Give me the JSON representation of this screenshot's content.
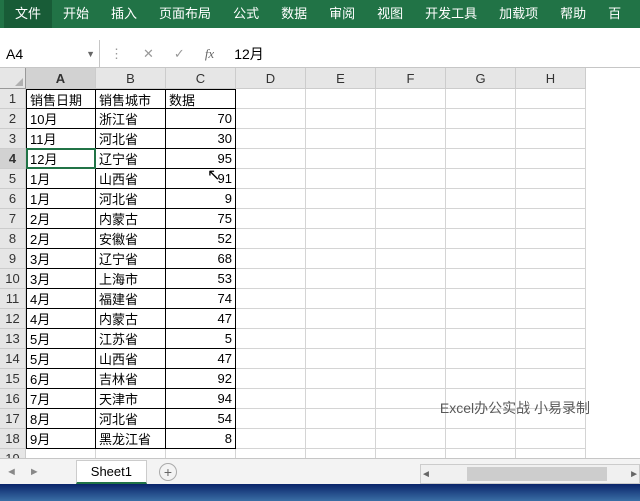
{
  "ribbon": [
    "文件",
    "开始",
    "插入",
    "页面布局",
    "公式",
    "数据",
    "审阅",
    "视图",
    "开发工具",
    "加载项",
    "帮助",
    "百"
  ],
  "nameBox": "A4",
  "formula": "12月",
  "colWidths": {
    "A": 70,
    "B": 70,
    "C": 70,
    "D": 70,
    "E": 70,
    "F": 70,
    "G": 70,
    "H": 70
  },
  "columns": [
    "A",
    "B",
    "C",
    "D",
    "E",
    "F",
    "G",
    "H"
  ],
  "selectedRow": 4,
  "selectedCol": "A",
  "headers": [
    "销售日期",
    "销售城市",
    "数据"
  ],
  "rows": [
    [
      "10月",
      "浙江省",
      "70"
    ],
    [
      "11月",
      "河北省",
      "30"
    ],
    [
      "12月",
      "辽宁省",
      "95"
    ],
    [
      "1月",
      "山西省",
      "91"
    ],
    [
      "1月",
      "河北省",
      "9"
    ],
    [
      "2月",
      "内蒙古",
      "75"
    ],
    [
      "2月",
      "安徽省",
      "52"
    ],
    [
      "3月",
      "辽宁省",
      "68"
    ],
    [
      "3月",
      "上海市",
      "53"
    ],
    [
      "4月",
      "福建省",
      "74"
    ],
    [
      "4月",
      "内蒙古",
      "47"
    ],
    [
      "5月",
      "江苏省",
      "5"
    ],
    [
      "5月",
      "山西省",
      "47"
    ],
    [
      "6月",
      "吉林省",
      "92"
    ],
    [
      "7月",
      "天津市",
      "94"
    ],
    [
      "8月",
      "河北省",
      "54"
    ],
    [
      "9月",
      "黑龙江省",
      "8"
    ]
  ],
  "totalVisibleRows": 19,
  "sheetTab": "Sheet1",
  "watermark": "Excel办公实战 小易录制"
}
